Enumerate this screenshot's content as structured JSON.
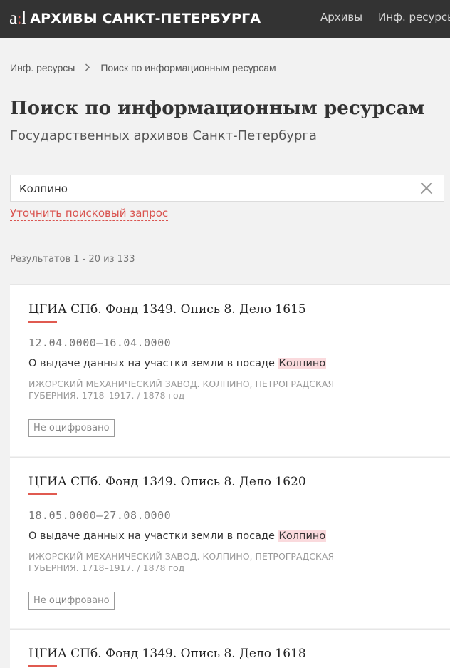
{
  "header": {
    "logo_mark_left": "a",
    "logo_mark_sep": ":",
    "logo_mark_right": "l",
    "logo_text": "АРХИВЫ САНКТ-ПЕТЕРБУРГА",
    "nav": [
      "Архивы",
      "Инф. ресурсы"
    ]
  },
  "breadcrumb": {
    "items": [
      "Инф. ресурсы",
      "Поиск по информационным ресурсам"
    ]
  },
  "page": {
    "title": "Поиск по информационным ресурсам",
    "subtitle": "Государственных архивов Санкт-Петербурга"
  },
  "search": {
    "value": "Колпино",
    "refine_label": "Уточнить поисковый запрос"
  },
  "results": {
    "count_label": "Результатов 1 - 20 из 133",
    "items": [
      {
        "title": "ЦГИА СПб. Фонд 1349. Опись 8. Дело 1615",
        "dates": "12.04.0000–16.04.0000",
        "desc_prefix": "О выдаче данных на участки земли в посаде ",
        "desc_highlight": "Колпино",
        "meta_line1": "ИЖОРСКИЙ МЕХАНИЧЕСКИЙ ЗАВОД. КОЛПИНО, ПЕТРОГРАДСКАЯ",
        "meta_line2": "ГУБЕРНИЯ. 1718–1917. / 1878 год",
        "badge": "Не оцифровано"
      },
      {
        "title": "ЦГИА СПб. Фонд 1349. Опись 8. Дело 1620",
        "dates": "18.05.0000–27.08.0000",
        "desc_prefix": "О выдаче данных на участки земли в посаде ",
        "desc_highlight": "Колпино",
        "meta_line1": "ИЖОРСКИЙ МЕХАНИЧЕСКИЙ ЗАВОД. КОЛПИНО, ПЕТРОГРАДСКАЯ",
        "meta_line2": "ГУБЕРНИЯ. 1718–1917. / 1878 год",
        "badge": "Не оцифровано"
      },
      {
        "title": "ЦГИА СПб. Фонд 1349. Опись 8. Дело 1618"
      }
    ]
  },
  "colors": {
    "header_bg": "#333333",
    "accent": "#e05a50",
    "highlight": "#fadadd",
    "page_bg": "#f2f2f2"
  },
  "icons": {
    "clear": "close-icon",
    "breadcrumb_separator": "chevron-right-icon"
  }
}
